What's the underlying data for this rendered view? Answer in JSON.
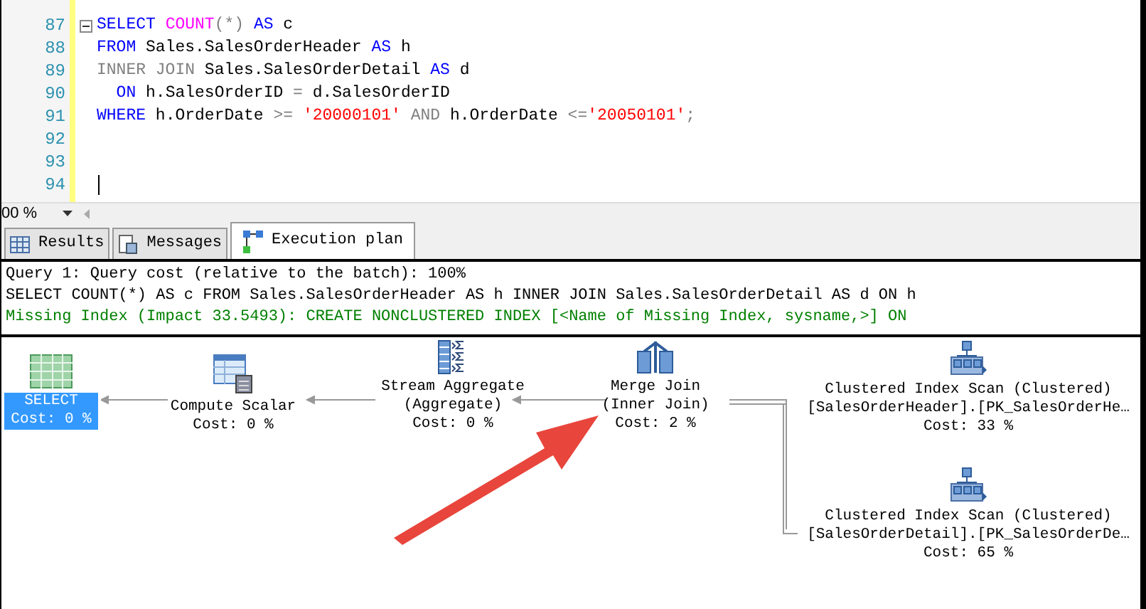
{
  "editor": {
    "lines": [
      {
        "number": "87",
        "collapse": true,
        "tokens": [
          {
            "kind": "keyword",
            "text": "SELECT"
          },
          {
            "kind": "function",
            "text": " COUNT"
          },
          {
            "kind": "operator",
            "text": "(*)"
          },
          {
            "kind": "keyword",
            "text": " AS"
          },
          {
            "kind": "plain",
            "text": " c"
          }
        ]
      },
      {
        "number": "88",
        "tokens": [
          {
            "kind": "keyword",
            "text": "FROM"
          },
          {
            "kind": "plain",
            "text": " Sales.SalesOrderHeader "
          },
          {
            "kind": "keyword",
            "text": "AS"
          },
          {
            "kind": "plain",
            "text": " h"
          }
        ]
      },
      {
        "number": "89",
        "tokens": [
          {
            "kind": "operator",
            "text": "INNER JOIN"
          },
          {
            "kind": "plain",
            "text": " Sales.SalesOrderDetail "
          },
          {
            "kind": "keyword",
            "text": "AS"
          },
          {
            "kind": "plain",
            "text": " d"
          }
        ]
      },
      {
        "number": "90",
        "tokens": [
          {
            "kind": "keyword",
            "text": "  ON"
          },
          {
            "kind": "plain",
            "text": " h.SalesOrderID "
          },
          {
            "kind": "operator",
            "text": "="
          },
          {
            "kind": "plain",
            "text": " d.SalesOrderID"
          }
        ]
      },
      {
        "number": "91",
        "tokens": [
          {
            "kind": "keyword",
            "text": "WHERE"
          },
          {
            "kind": "plain",
            "text": " h.OrderDate "
          },
          {
            "kind": "operator",
            "text": ">="
          },
          {
            "kind": "string",
            "text": " '20000101'"
          },
          {
            "kind": "operator",
            "text": " AND"
          },
          {
            "kind": "plain",
            "text": " h.OrderDate "
          },
          {
            "kind": "operator",
            "text": "<="
          },
          {
            "kind": "string",
            "text": "'20050101'"
          },
          {
            "kind": "operator",
            "text": ";"
          }
        ]
      },
      {
        "number": "92"
      },
      {
        "number": "93"
      },
      {
        "number": "94"
      }
    ],
    "zoom": "00 %"
  },
  "tabs": [
    {
      "label": "Results",
      "selected": false
    },
    {
      "label": "Messages",
      "selected": false
    },
    {
      "label": "Execution plan",
      "selected": true
    }
  ],
  "plan_header": {
    "query_cost": "Query 1: Query cost (relative to the batch): 100%",
    "statement": "SELECT COUNT(*) AS c FROM Sales.SalesOrderHeader AS h INNER JOIN Sales.SalesOrderDetail AS d ON h",
    "missing_index": "Missing Index (Impact 33.5493): CREATE NONCLUSTERED INDEX [<Name of Missing Index, sysname,>] ON"
  },
  "plan_nodes": [
    {
      "kind": "select",
      "lines": [
        "SELECT",
        "Cost: 0 %"
      ],
      "selected": true
    },
    {
      "kind": "compute",
      "lines": [
        "Compute Scalar",
        "Cost: 0 %"
      ],
      "selected": false
    },
    {
      "kind": "aggregate",
      "lines": [
        "Stream Aggregate",
        "(Aggregate)",
        "Cost: 0 %"
      ],
      "selected": false
    },
    {
      "kind": "merge",
      "lines": [
        "Merge Join",
        "(Inner Join)",
        "Cost: 2 %"
      ],
      "selected": false
    },
    {
      "kind": "scan",
      "lines": [
        "Clustered Index Scan (Clustered)",
        "[SalesOrderHeader].[PK_SalesOrderHe…",
        "Cost: 33 %"
      ],
      "selected": false
    },
    {
      "kind": "scan",
      "lines": [
        "Clustered Index Scan (Clustered)",
        "[SalesOrderDetail].[PK_SalesOrderDe…",
        "Cost: 65 %"
      ],
      "selected": false
    }
  ]
}
